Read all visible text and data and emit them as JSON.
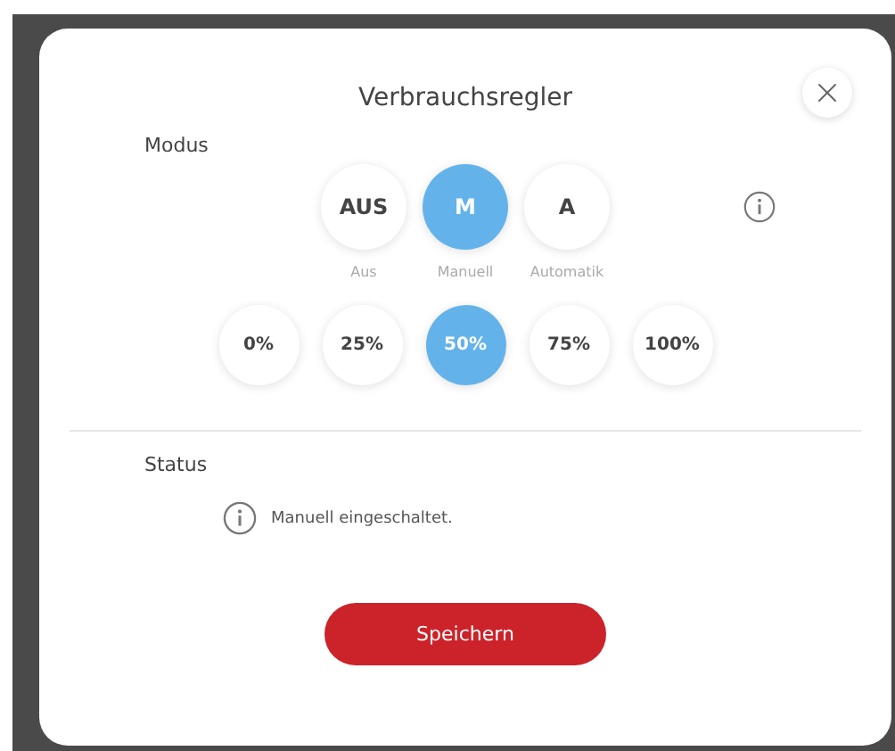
{
  "dialog": {
    "title": "Verbrauchsregler"
  },
  "mode": {
    "label": "Modus",
    "options": [
      {
        "short": "AUS",
        "label": "Aus",
        "selected": false
      },
      {
        "short": "M",
        "label": "Manuell",
        "selected": true
      },
      {
        "short": "A",
        "label": "Automatik",
        "selected": false
      }
    ]
  },
  "power_levels": [
    {
      "label": "0%",
      "selected": false
    },
    {
      "label": "25%",
      "selected": false
    },
    {
      "label": "50%",
      "selected": true
    },
    {
      "label": "75%",
      "selected": false
    },
    {
      "label": "100%",
      "selected": false
    }
  ],
  "status": {
    "label": "Status",
    "message": "Manuell eingeschaltet."
  },
  "save_button": "Speichern"
}
